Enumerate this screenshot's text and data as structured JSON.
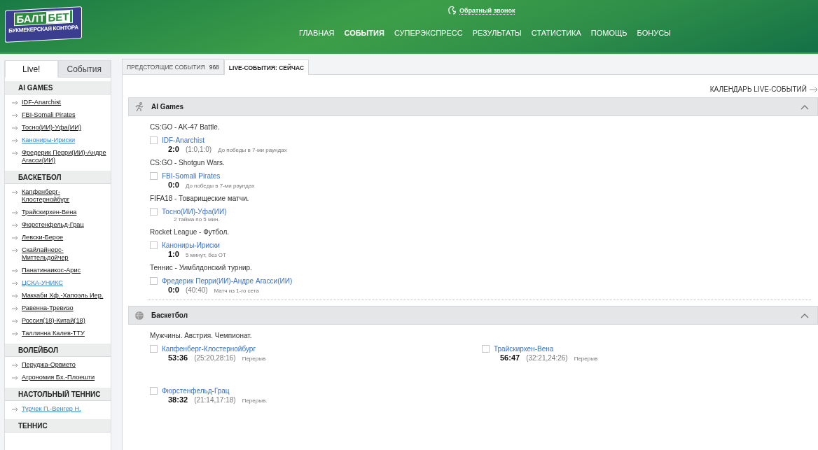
{
  "logo": {
    "word_1": "БАЛТ",
    "word_2": "БЕТ",
    "tagline": "БУКМЕКЕРСКАЯ КОНТОРА"
  },
  "callback": "Обратный звонок",
  "nav": [
    {
      "label": "ГЛАВНАЯ",
      "selected": false
    },
    {
      "label": "СОБЫТИЯ",
      "selected": true
    },
    {
      "label": "СУПЕРЭКСПРЕСС",
      "selected": false
    },
    {
      "label": "РЕЗУЛЬТАТЫ",
      "selected": false
    },
    {
      "label": "СТАТИСТИКА",
      "selected": false
    },
    {
      "label": "ПОМОЩЬ",
      "selected": false
    },
    {
      "label": "БОНУСЫ",
      "selected": false
    }
  ],
  "sidebar": {
    "tabs": [
      {
        "label": "Live!",
        "selected": true
      },
      {
        "label": "События",
        "selected": false
      }
    ],
    "sections": [
      {
        "title": "AI GAMES",
        "items": [
          {
            "label": "IDF-Anarchist",
            "highlighted": false
          },
          {
            "label": "FBI-Somali Pirates",
            "highlighted": false
          },
          {
            "label": "Тосно(ИИ)-Уфа(ИИ)",
            "highlighted": false
          },
          {
            "label": "Канониры-Ириски",
            "highlighted": true
          },
          {
            "label": "Фредерик Перри(ИИ)-Андре Агасси(ИИ)",
            "highlighted": false
          }
        ]
      },
      {
        "title": "БАСКЕТБОЛ",
        "items": [
          {
            "label": "Капфенберг-Клостернойбург",
            "highlighted": false
          },
          {
            "label": "Трайскирхен-Вена",
            "highlighted": false
          },
          {
            "label": "Фюрстенфельд-Грац",
            "highlighted": false
          },
          {
            "label": "Левски-Берое",
            "highlighted": false
          },
          {
            "label": "Скайлайнерс-Миттельдойчер",
            "highlighted": false
          },
          {
            "label": "Панатинаикос-Арис",
            "highlighted": false
          },
          {
            "label": "ЦСКА-УНИКС",
            "highlighted": true
          },
          {
            "label": "Маккаби Хф.-Хапоэль Иер.",
            "highlighted": false
          },
          {
            "label": "Равенна-Тревизо",
            "highlighted": false
          },
          {
            "label": "Россия(18)-Китай(18)",
            "highlighted": false
          },
          {
            "label": "Таллинна Калев-ТТУ",
            "highlighted": false
          }
        ]
      },
      {
        "title": "ВОЛЕЙБОЛ",
        "items": [
          {
            "label": "Перуджа-Орвието",
            "highlighted": false
          },
          {
            "label": "Агрономия Бх.-Плоешти",
            "highlighted": false
          }
        ]
      },
      {
        "title": "НАСТОЛЬНЫЙ ТЕННИС",
        "items": [
          {
            "label": "Турчек П.-Венгер Н.",
            "highlighted": true
          }
        ]
      },
      {
        "title": "ТЕННИС"
      }
    ]
  },
  "main": {
    "tabs": [
      {
        "label": "ПРЕДСТОЯЩИЕ СОБЫТИЯ",
        "count": "968",
        "selected": false
      },
      {
        "label": "LIVE-СОБЫТИЯ: СЕЙЧАС",
        "selected": true
      }
    ],
    "calendar_link": "КАЛЕНДАРЬ LIVE-СОБЫТИЙ",
    "sports": [
      {
        "title": "AI Games",
        "kind": "list",
        "expanded": true,
        "groups": [
          {
            "title": "CS:GO - AK-47 Battle.",
            "events": [
              {
                "name": "IDF-Anarchist",
                "checked": false,
                "score": "2:0",
                "periods": "(1:0,1:0)",
                "note": "До победы в 7-ми раундах"
              }
            ]
          },
          {
            "title": "CS:GO - Shotgun Wars.",
            "events": [
              {
                "name": "FBI-Somali Pirates",
                "checked": false,
                "score": "0:0",
                "note": "До победы в 7-ми раундах"
              }
            ]
          },
          {
            "title": "FIFA18 - Товарищеские матчи.",
            "events": [
              {
                "name": "Тосно(ИИ)-Уфа(ИИ)",
                "checked": false,
                "note": "2 тайма по 5 мин."
              }
            ]
          },
          {
            "title": "Rocket League - Футбол.",
            "events": [
              {
                "name": "Канониры-Ириски",
                "checked": false,
                "score": "1:0",
                "note": "5 минут, без ОТ"
              }
            ]
          },
          {
            "title": "Теннис - Уимблдонский турнир.",
            "events": [
              {
                "name": "Фредерик Перри(ИИ)-Андре Агасси(ИИ)",
                "checked": false,
                "score": "0:0",
                "periods": "(40:40)",
                "note": "Матч из 1-го сета"
              }
            ]
          }
        ]
      },
      {
        "title": "Баскетбол",
        "kind": "grid",
        "expanded": true,
        "groups": [
          {
            "title": "Мужчины. Австрия. Чемпионат.",
            "events": [
              {
                "name": "Капфенберг-Клостернойбург",
                "checked": false,
                "score": "53:36",
                "periods": "(25:20,28:16)",
                "note": "Перерыв"
              },
              {
                "name": "Трайскирхен-Вена",
                "checked": false,
                "score": "56:47",
                "periods": "(32:21,24:26)",
                "note": "Перерыв"
              },
              {
                "name": "Фюрстенфельд-Грац",
                "checked": false,
                "score": "38:32",
                "periods": "(21:14,17:18)",
                "note": "Перерыв."
              }
            ]
          }
        ]
      }
    ]
  }
}
